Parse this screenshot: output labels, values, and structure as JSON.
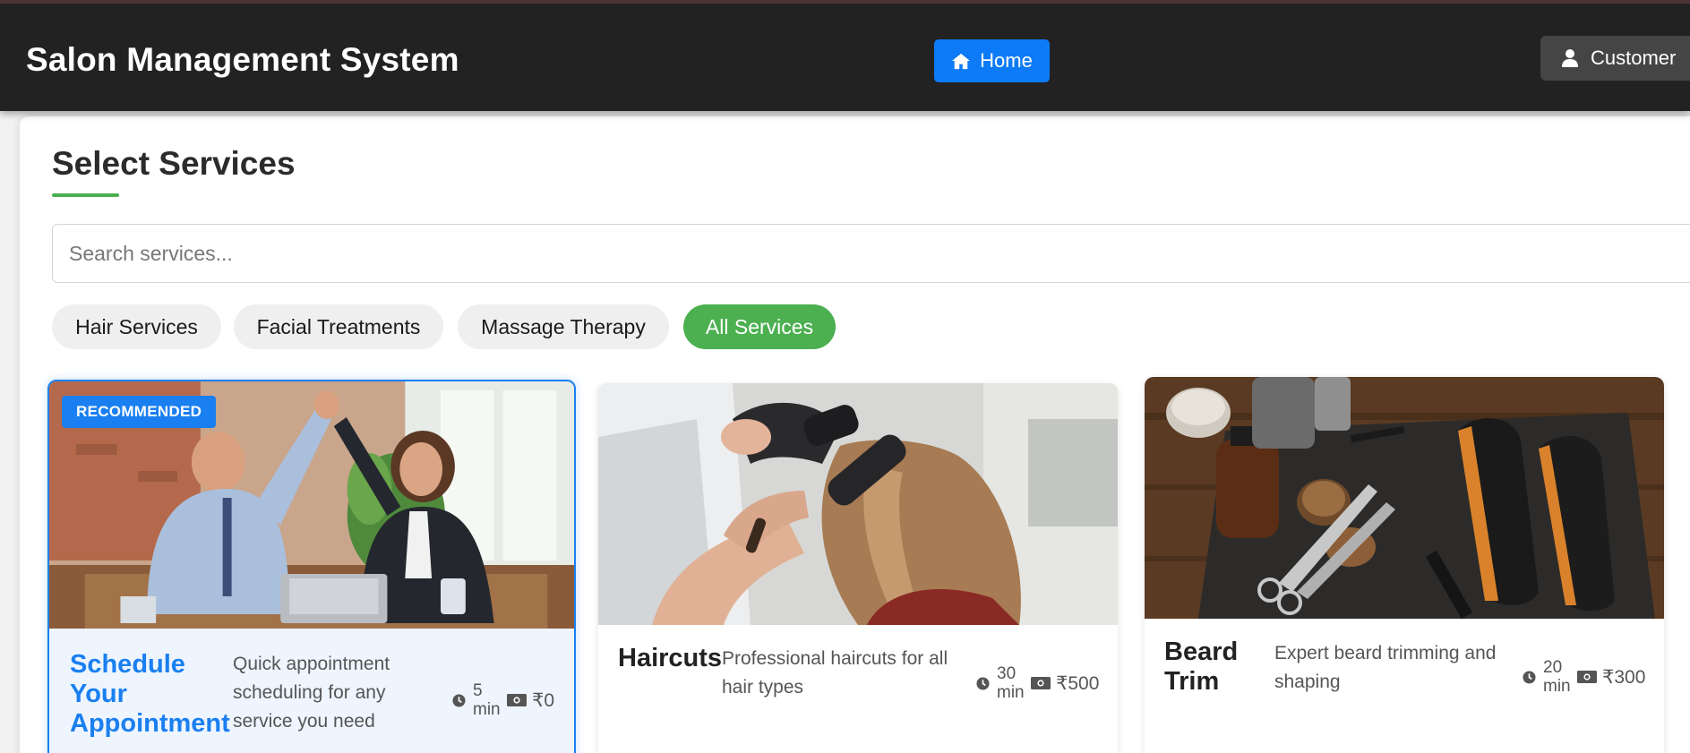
{
  "header": {
    "app_title": "Salon Management System",
    "home_label": "Home",
    "user_label": "Customer"
  },
  "main": {
    "title": "Select Services",
    "search": {
      "placeholder": "Search services...",
      "value": ""
    },
    "categories": [
      {
        "label": "Hair Services",
        "active": false
      },
      {
        "label": "Facial Treatments",
        "active": false
      },
      {
        "label": "Massage Therapy",
        "active": false
      },
      {
        "label": "All Services",
        "active": true
      }
    ],
    "services": [
      {
        "badge": "RECOMMENDED",
        "name": "Schedule Your Appointment",
        "description": "Quick appointment scheduling for any service you need",
        "duration_value": "5",
        "duration_unit": "min",
        "price": "₹0"
      },
      {
        "name": "Haircuts",
        "description": "Professional haircuts for all hair types",
        "duration_value": "30",
        "duration_unit": "min",
        "price": "₹500"
      },
      {
        "name": "Beard Trim",
        "description": "Expert beard trimming and shaping",
        "duration_value": "20",
        "duration_unit": "min",
        "price": "₹300"
      }
    ]
  },
  "icons": {
    "home": "home-icon",
    "user": "user-icon",
    "clock": "clock-icon",
    "cash": "money-icon"
  },
  "colors": {
    "header_bg": "#222222",
    "primary": "#0d7bf7",
    "accent_green": "#4caf50",
    "featured_border": "#1a7ff0"
  }
}
